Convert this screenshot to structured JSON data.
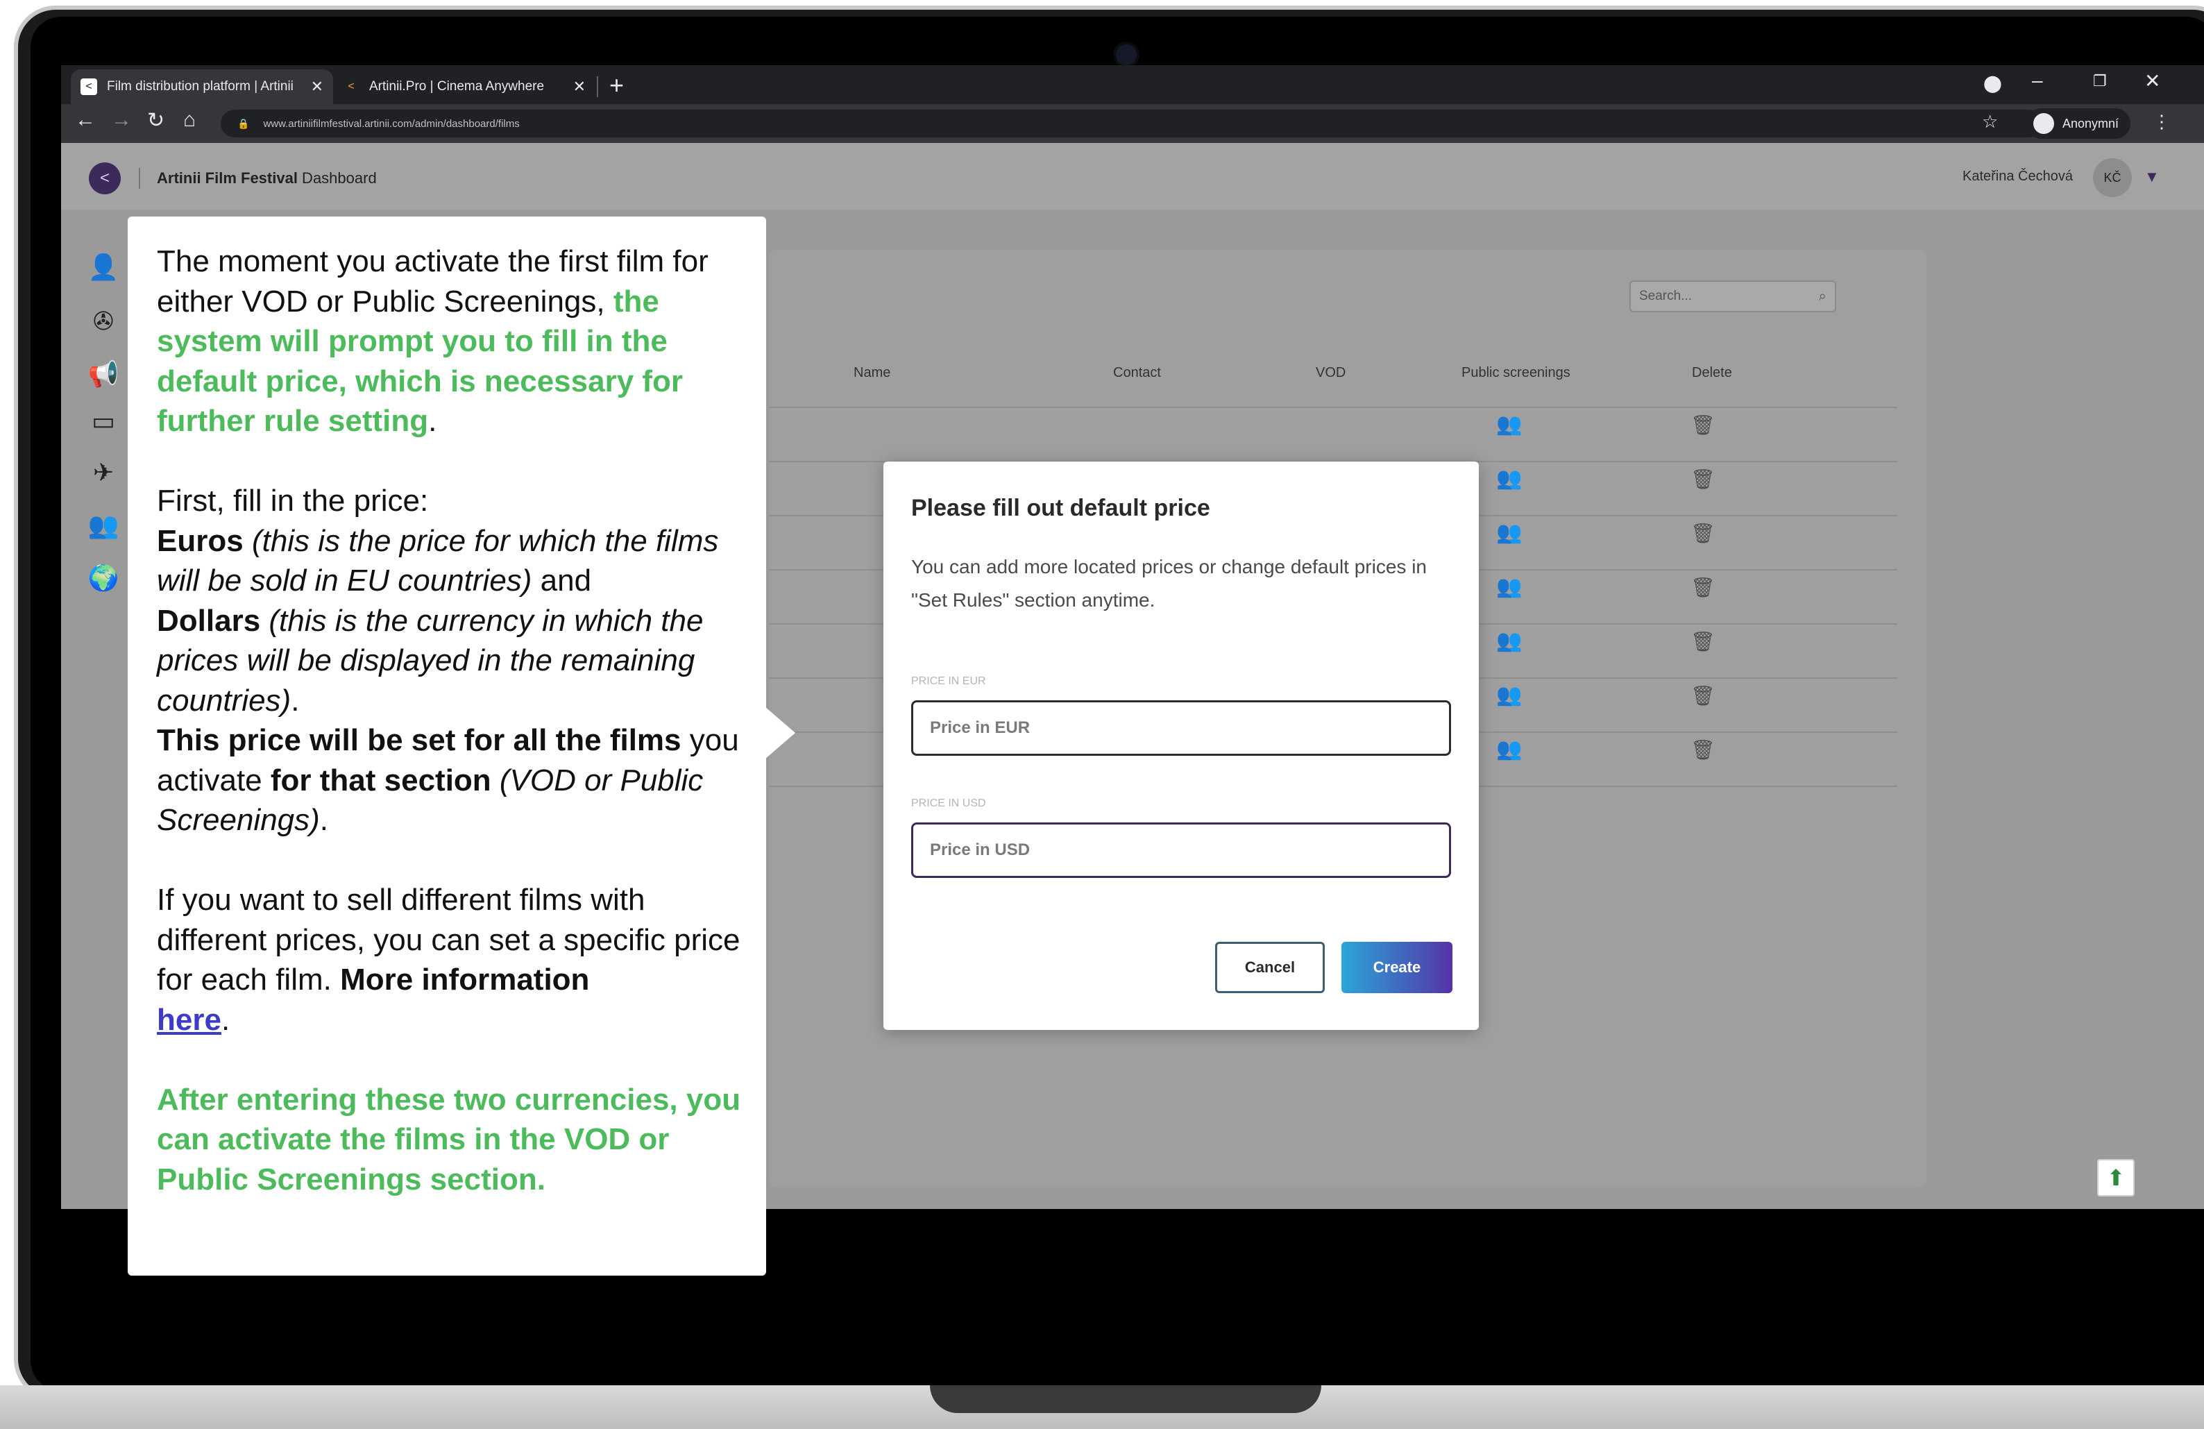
{
  "browser": {
    "tabs": [
      {
        "title": "Film distribution platform | Artinii",
        "active": true
      },
      {
        "title": "Artinii.Pro | Cinema Anywhere",
        "active": false
      }
    ],
    "url": "www.artiniifilmfestival.artinii.com/admin/dashboard/films",
    "profile_label": "Anonymní"
  },
  "app": {
    "brand_bold": "Artinii Film Festival",
    "brand_rest": " Dashboard",
    "user_name": "Kateřina Čechová",
    "user_initials": "KČ"
  },
  "table": {
    "search_placeholder": "Search...",
    "headers": [
      "Name",
      "Contact",
      "VOD",
      "Public screenings",
      "Delete"
    ],
    "row_count": 7
  },
  "modal": {
    "title": "Please fill out default price",
    "description": "You can add more located prices or change default prices in \"Set Rules\" section anytime.",
    "eur_label": "PRICE IN EUR",
    "eur_placeholder": "Price in EUR",
    "eur_value": "",
    "usd_label": "PRICE IN USD",
    "usd_placeholder": "Price in USD",
    "usd_value": "",
    "cancel_label": "Cancel",
    "create_label": "Create"
  },
  "callout": {
    "p1_plain": "The moment you activate the first film for either VOD or Public Screenings, ",
    "p1_green": "the system will prompt you to fill in the default price, which is necessary for further rule setting",
    "p1_end": ".",
    "p2_intro": "First, fill in the price:",
    "p2_euros": "Euros",
    "p2_euros_note": "(this is the price for which the films will be sold in EU countries)",
    "p2_and": " and",
    "p2_dollars": "Dollars",
    "p2_dollars_note": "(this is the currency in which the prices will be displayed in the remaining countries)",
    "p2_dollars_end": ".",
    "p2_set_bold1": "This price will be set for all the films",
    "p2_set_mid": " you activate ",
    "p2_set_bold2": "for that section",
    "p2_set_note": " (VOD or Public Screenings)",
    "p2_set_end": ".",
    "p3_plain": "If you want to sell different films with different prices, you can set a specific price for each film. ",
    "p3_bold": "More information",
    "p3_link": "here",
    "p3_end": ".",
    "p4_green": "After entering these two currencies, you can activate the films in the VOD or Public Screenings section."
  },
  "colors": {
    "green": "#4dbb5c",
    "purple": "#3d2a5a",
    "link": "#3c3cc8"
  }
}
